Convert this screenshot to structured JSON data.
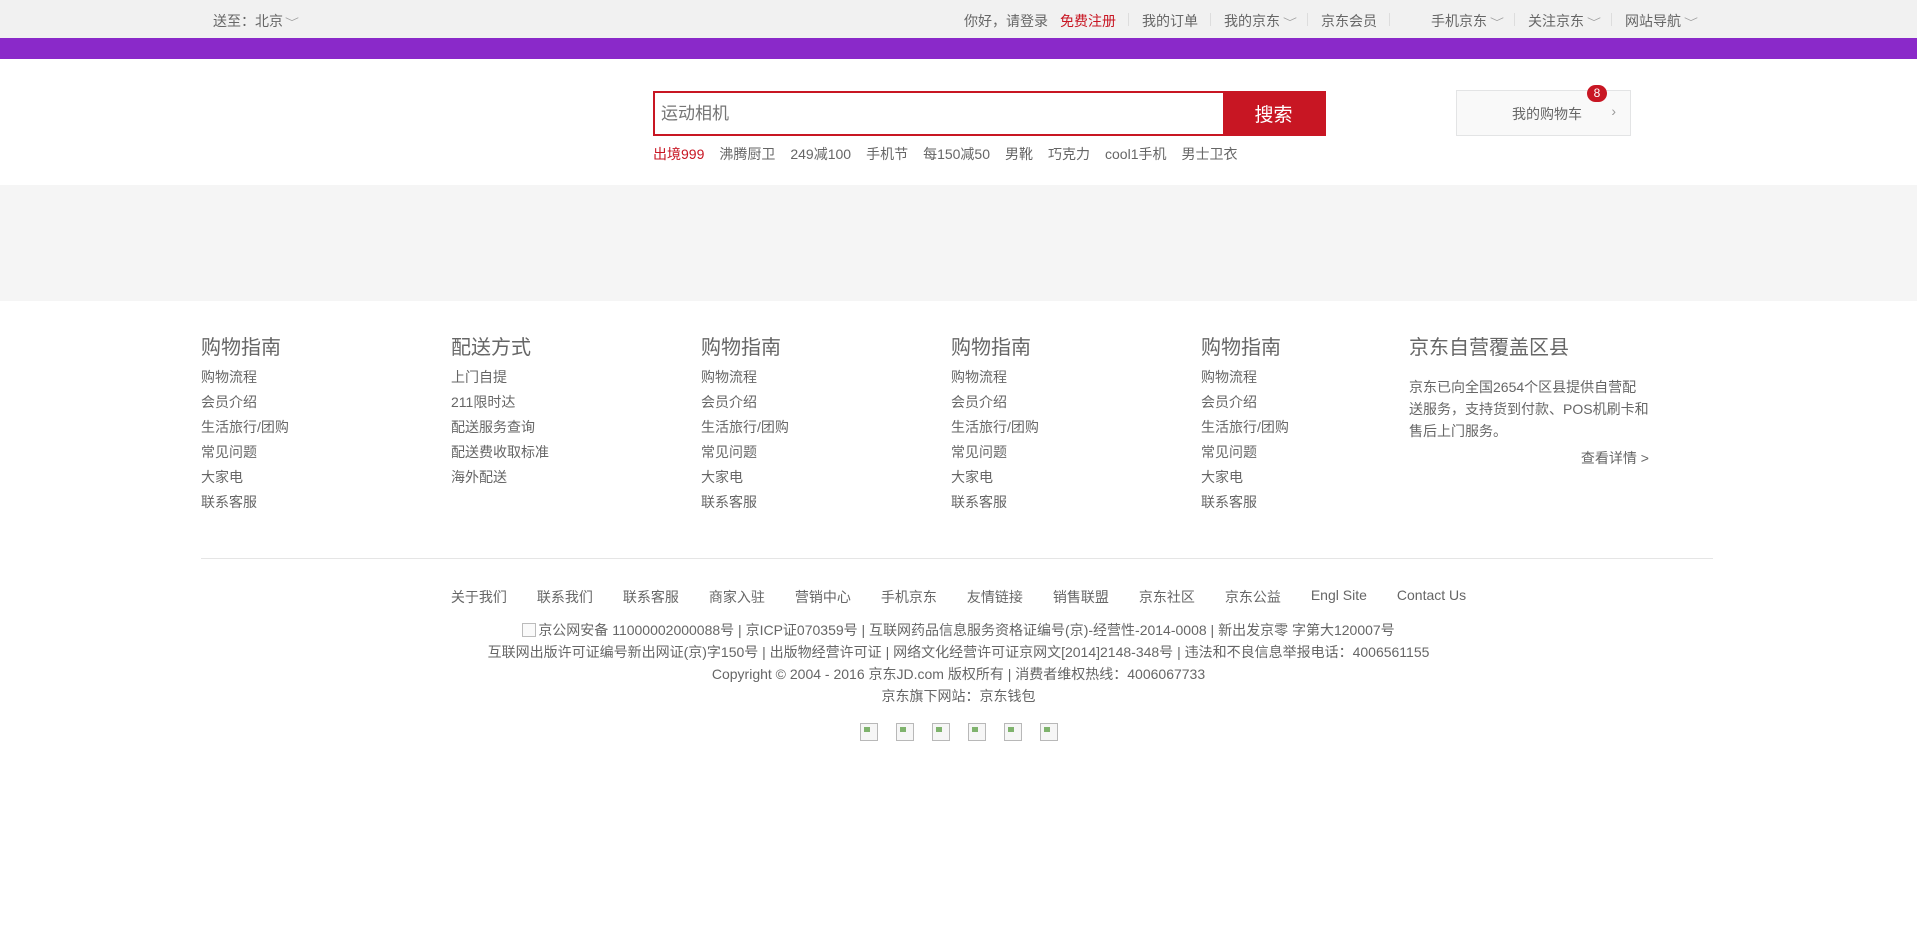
{
  "topbar": {
    "location_label": "送至：北京",
    "greeting": "你好，请登录",
    "register": "免费注册",
    "my_orders": "我的订单",
    "my_jd": "我的京东",
    "member": "京东会员",
    "mobile_jd": "手机京东",
    "follow_jd": "关注京东",
    "site_nav": "网站导航"
  },
  "search": {
    "placeholder": "运动相机",
    "button": "搜索",
    "hotwords": [
      "出境999",
      "沸腾厨卫",
      "249减100",
      "手机节",
      "每150减50",
      "男靴",
      "巧克力",
      "cool1手机",
      "男士卫衣"
    ]
  },
  "cart": {
    "label": "我的购物车",
    "count": "8"
  },
  "help": [
    {
      "title": "购物指南",
      "items": [
        "购物流程",
        "会员介绍",
        "生活旅行/团购",
        "常见问题",
        "大家电",
        "联系客服"
      ]
    },
    {
      "title": "配送方式",
      "items": [
        "上门自提",
        "211限时达",
        "配送服务查询",
        "配送费收取标准",
        "海外配送"
      ]
    },
    {
      "title": "购物指南",
      "items": [
        "购物流程",
        "会员介绍",
        "生活旅行/团购",
        "常见问题",
        "大家电",
        "联系客服"
      ]
    },
    {
      "title": "购物指南",
      "items": [
        "购物流程",
        "会员介绍",
        "生活旅行/团购",
        "常见问题",
        "大家电",
        "联系客服"
      ]
    },
    {
      "title": "购物指南",
      "items": [
        "购物流程",
        "会员介绍",
        "生活旅行/团购",
        "常见问题",
        "大家电",
        "联系客服"
      ]
    }
  ],
  "coverage": {
    "title": "京东自营覆盖区县",
    "text": "京东已向全国2654个区县提供自营配送服务，支持货到付款、POS机刷卡和售后上门服务。",
    "more": "查看详情 >"
  },
  "footer_links": [
    "关于我们",
    "联系我们",
    "联系客服",
    "商家入驻",
    "营销中心",
    "手机京东",
    "友情链接",
    "销售联盟",
    "京东社区",
    "京东公益",
    "Engl Site",
    "Contact Us"
  ],
  "copyright": {
    "line1": "京公网安备 11000002000088号 | 京ICP证070359号 | 互联网药品信息服务资格证编号(京)-经营性-2014-0008 | 新出发京零 字第大120007号",
    "line2": "互联网出版许可证编号新出网证(京)字150号 | 出版物经营许可证 | 网络文化经营许可证京网文[2014]2148-348号 | 违法和不良信息举报电话：4006561155",
    "line3": "Copyright © 2004 - 2016 京东JD.com 版权所有 | 消费者维权热线：4006067733",
    "line4": "京东旗下网站：京东钱包"
  }
}
